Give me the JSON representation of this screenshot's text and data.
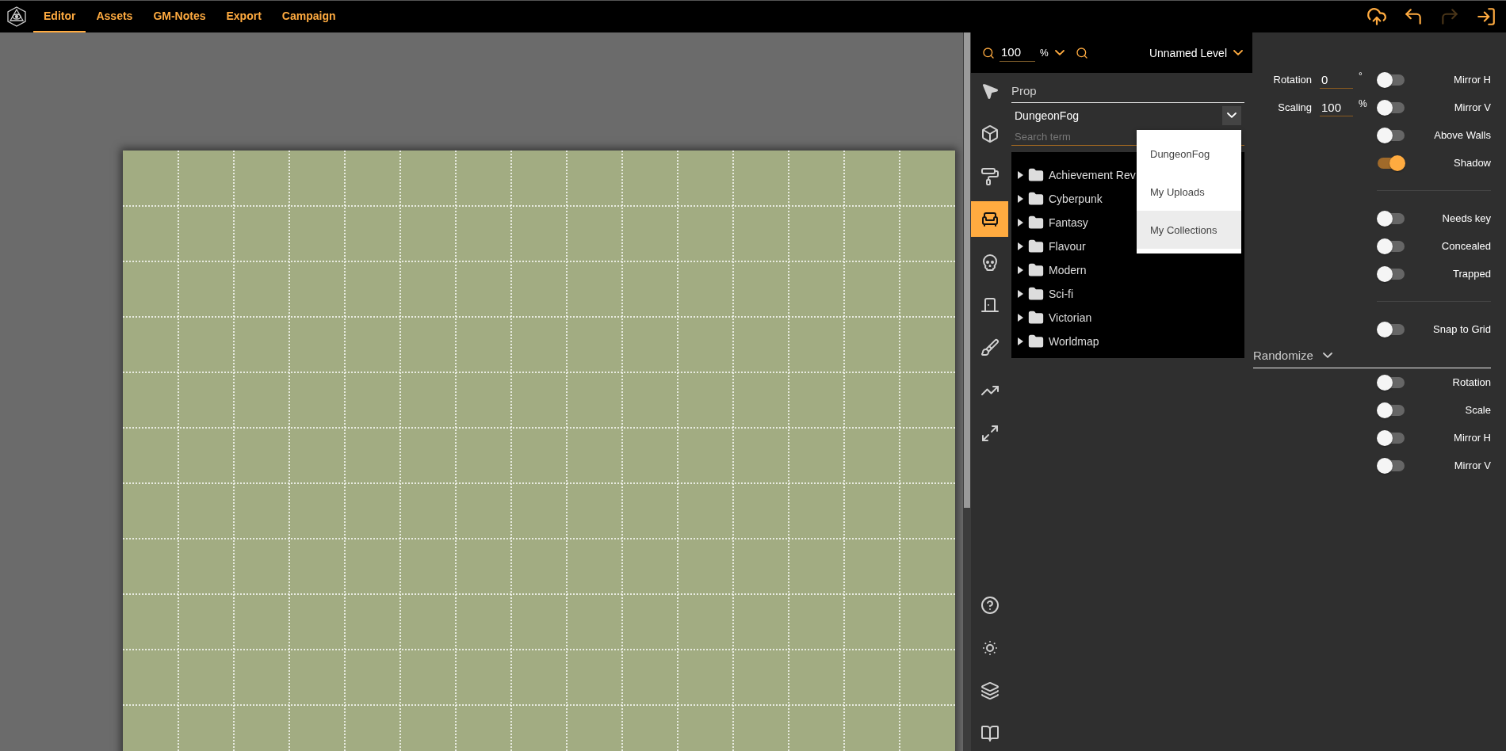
{
  "nav_tabs": [
    {
      "label": "Editor",
      "selected": true
    },
    {
      "label": "Assets",
      "selected": false
    },
    {
      "label": "GM-Notes",
      "selected": false
    },
    {
      "label": "Export",
      "selected": false
    },
    {
      "label": "Campaign",
      "selected": false
    }
  ],
  "top_actions": [
    {
      "kind": "upload",
      "disabled": false
    },
    {
      "kind": "undo",
      "disabled": false
    },
    {
      "kind": "redo",
      "disabled": true
    },
    {
      "kind": "exit",
      "disabled": false
    }
  ],
  "zoom": {
    "value": "100",
    "unit": "%"
  },
  "level_selector": {
    "label": "Unnamed Level"
  },
  "tools": [
    {
      "kind": "pointer",
      "selected": false
    },
    {
      "kind": "cube",
      "selected": false
    },
    {
      "kind": "roller",
      "selected": false
    },
    {
      "kind": "chair",
      "selected": true
    },
    {
      "kind": "skull",
      "selected": false
    },
    {
      "kind": "door",
      "selected": false
    },
    {
      "kind": "brush",
      "selected": false
    },
    {
      "kind": "line",
      "selected": false
    },
    {
      "kind": "expand",
      "selected": false
    }
  ],
  "utility_tools": [
    {
      "kind": "help"
    },
    {
      "kind": "sun"
    },
    {
      "kind": "layers"
    },
    {
      "kind": "book"
    }
  ],
  "prop_panel": {
    "title": "Prop",
    "source": "DungeonFog",
    "search_placeholder": "Search term",
    "source_menu": [
      {
        "label": "DungeonFog",
        "highlighted": false
      },
      {
        "label": "My Uploads",
        "highlighted": false
      },
      {
        "label": "My Collections",
        "highlighted": true
      }
    ],
    "folders": [
      {
        "label": "Achievement Rev",
        "expanded": false
      },
      {
        "label": "Cyberpunk",
        "expanded": false
      },
      {
        "label": "Fantasy",
        "expanded": false
      },
      {
        "label": "Flavour",
        "expanded": false
      },
      {
        "label": "Modern",
        "expanded": false
      },
      {
        "label": "Sci-fi",
        "expanded": false
      },
      {
        "label": "Victorian",
        "expanded": false
      },
      {
        "label": "Worldmap",
        "expanded": false
      }
    ]
  },
  "transform": [
    {
      "label": "Rotation",
      "value": "0",
      "unit": "°"
    },
    {
      "label": "Scaling",
      "value": "100",
      "unit": "%"
    }
  ],
  "toggle_groups": [
    {
      "toggles": [
        {
          "label": "Mirror H",
          "on": false
        },
        {
          "label": "Mirror V",
          "on": false
        },
        {
          "label": "Above Walls",
          "on": false
        },
        {
          "label": "Shadow",
          "on": true
        }
      ]
    },
    {
      "toggles": [
        {
          "label": "Needs key",
          "on": false
        },
        {
          "label": "Concealed",
          "on": false
        },
        {
          "label": "Trapped",
          "on": false
        }
      ]
    },
    {
      "toggles": [
        {
          "label": "Snap to Grid",
          "on": false
        }
      ]
    }
  ],
  "randomize": {
    "title": "Randomize",
    "toggles": [
      {
        "label": "Rotation",
        "on": false
      },
      {
        "label": "Scale",
        "on": false
      },
      {
        "label": "Mirror H",
        "on": false
      },
      {
        "label": "Mirror V",
        "on": false
      }
    ]
  }
}
